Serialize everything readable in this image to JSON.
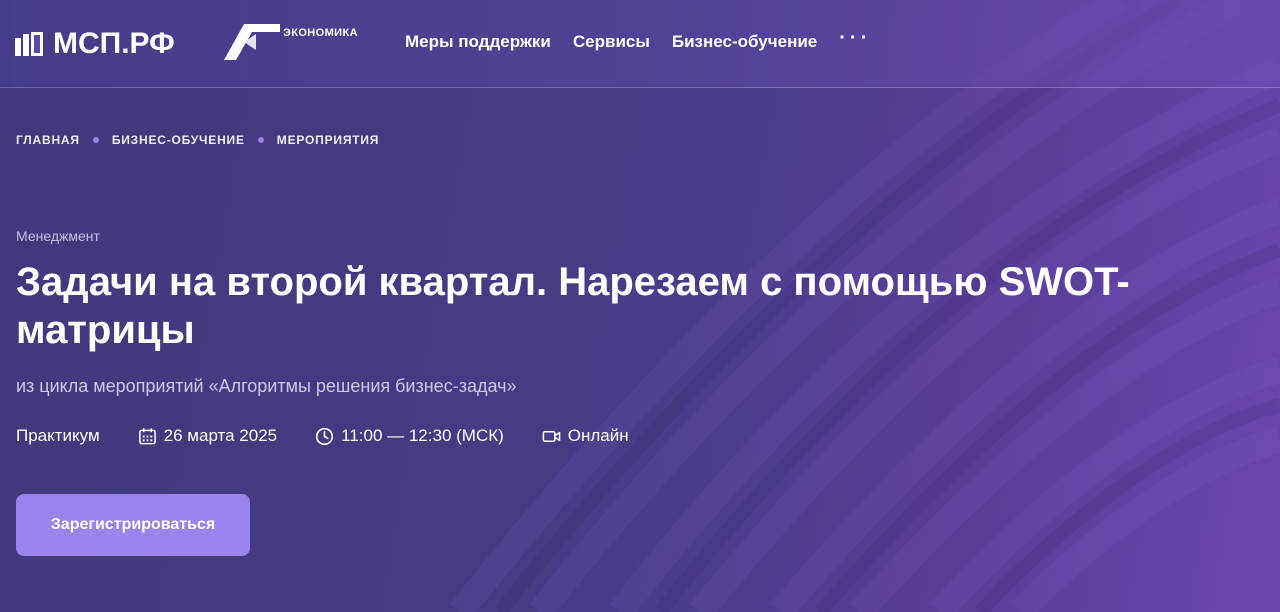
{
  "header": {
    "logo_text": "МСП.РФ",
    "partner_label": "ЭКОНОМИКА",
    "nav": {
      "item_1": "Меры поддержки",
      "item_2": "Сервисы",
      "item_3": "Бизнес-обучение",
      "more": "···"
    }
  },
  "breadcrumb": {
    "item_1": "ГЛАВНАЯ",
    "item_2": "БИЗНЕС-ОБУЧЕНИЕ",
    "item_3": "МЕРОПРИЯТИЯ"
  },
  "event": {
    "category": "Менеджмент",
    "title": "Задачи на второй квартал. Нарезаем с помощью SWOT-матрицы",
    "series": "из цикла мероприятий «Алгоритмы решения бизнес-задач»",
    "format": "Практикум",
    "date": "26 марта 2025",
    "time": "11:00 — 12:30 (МСК)",
    "mode": "Онлайн",
    "register_label": "Зарегистрироваться"
  },
  "icons": {
    "date": "calendar-icon",
    "time": "clock-icon",
    "mode": "video-camera-icon"
  },
  "colors": {
    "background": "#40397a",
    "accent": "#9b83ee",
    "breadcrumb_dot": "#9a84e8"
  }
}
